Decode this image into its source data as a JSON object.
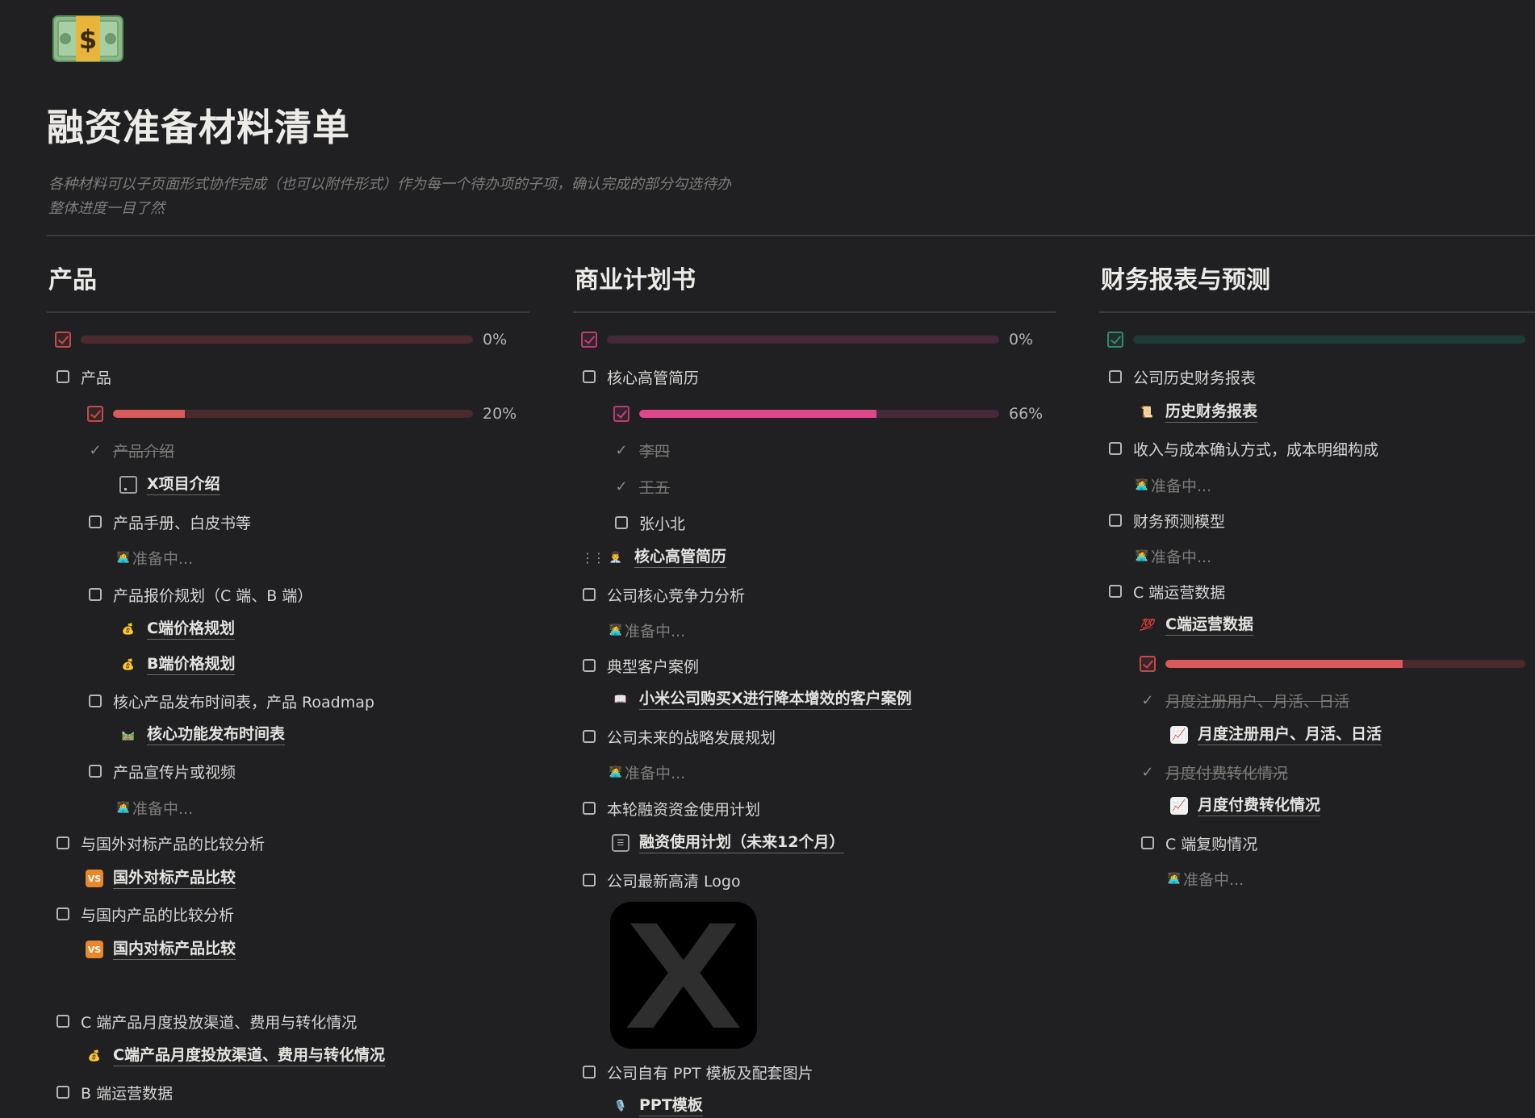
{
  "page": {
    "title": "融资准备材料清单",
    "description": [
      "各种材料可以子页面形式协作完成（也可以附件形式）作为每一个待办项的子项，确认完成的部分勾选待办",
      "整体进度一目了然"
    ],
    "pending_text": "准备中..."
  },
  "columns": [
    {
      "heading": "产品",
      "progress_pct": "0%",
      "progress_value": 0,
      "items": {
        "product": "产品",
        "sub_progress_pct": "20%",
        "sub_progress_value": 0.2,
        "product_intro": "产品介绍",
        "x_project_intro": "X项目介绍",
        "handbook": "产品手册、白皮书等",
        "pricing": "产品报价规划（C 端、B 端）",
        "c_pricing": "C端价格规划",
        "b_pricing": "B端价格规划",
        "roadmap": "核心产品发布时间表，产品 Roadmap",
        "roadmap_page": "核心功能发布时间表",
        "video": "产品宣传片或视频",
        "foreign": "与国外对标产品的比较分析",
        "foreign_page": "国外对标产品比较",
        "domestic": "与国内产品的比较分析",
        "domestic_page": "国内对标产品比较",
        "c_channel": "C 端产品月度投放渠道、费用与转化情况",
        "c_channel_page": "C端产品月度投放渠道、费用与转化情况",
        "b_ops": "B 端运营数据"
      }
    },
    {
      "heading": "商业计划书",
      "progress_pct": "0%",
      "progress_value": 0,
      "items": {
        "exec_resume": "核心高管简历",
        "sub_progress_pct": "66%",
        "sub_progress_value": 0.66,
        "li_si": "李四",
        "wang_wu": "王五",
        "zhang": "张小北",
        "exec_resume_page": "核心高管简历",
        "competitive": "公司核心竞争力分析",
        "case": "典型客户案例",
        "case_page": "小米公司购买X进行降本增效的客户案例",
        "strategy": "公司未来的战略发展规划",
        "funding": "本轮融资资金使用计划",
        "funding_page": "融资使用计划（未来12个月）",
        "logo": "公司最新高清 Logo",
        "logo_glyph": "X",
        "ppt": "公司自有 PPT 模板及配套图片",
        "ppt_page": "PPT模板"
      }
    },
    {
      "heading": "财务报表与预测",
      "progress_value": 0,
      "items": {
        "history": "公司历史财务报表",
        "history_page": "历史财务报表",
        "revenue": "收入与成本确认方式，成本明细构成",
        "forecast": "财务预测模型",
        "c_ops": "C 端运营数据",
        "c_ops_page": "C端运营数据",
        "sub_progress_value": 0.66,
        "monthly_users": "月度注册用户、月活、日活",
        "monthly_users_page": "月度注册用户、月活、日活",
        "paid_conv": "月度付费转化情况",
        "paid_conv_page": "月度付费转化情况",
        "repurchase": "C 端复购情况"
      }
    }
  ],
  "colors": {
    "background": "#202023",
    "bar_red_track": "#4a2a2c",
    "bar_red_fill": "#d85a5a",
    "bar_pink_track": "#45283a",
    "bar_pink_fill": "#e0478a",
    "bar_green_track": "#1f3b35"
  }
}
